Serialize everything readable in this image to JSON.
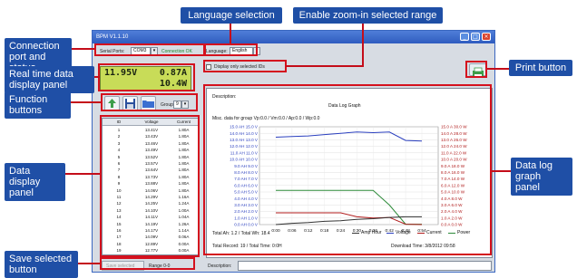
{
  "callouts": {
    "language_selection": "Language selection",
    "enable_zoom": "Enable zoom-in selected range",
    "connection_port": "Connection\nport and status",
    "realtime_display": "Real time data\ndisplay panel",
    "function_buttons": "Function\nbuttons",
    "data_display": "Data display\npanel",
    "save_selected": "Save selected\nbutton",
    "print_button": "Print button",
    "data_log_graph": "Data log\ngraph panel"
  },
  "app": {
    "title": "BPM V1.1.10",
    "serial_label": "Serial Ports:",
    "serial_value": "COM3",
    "connection_status": "Connection OK",
    "language_label": "Language:",
    "language_value": "English",
    "display_only_label": "Display only selected IDs",
    "lcd_voltage": "11.95V",
    "lcd_current": "0.87A",
    "lcd_power": "10.4W",
    "group_label": "Group",
    "group_value": "9",
    "save_selected_label": "Save selected",
    "range_label": "Range 0-0",
    "description_bottom_label": "Description:"
  },
  "table": {
    "headers": [
      "ID",
      "Voltage",
      "Current"
    ],
    "rows": [
      [
        "1",
        "13.41V",
        "1.80A"
      ],
      [
        "2",
        "13.43V",
        "1.80A"
      ],
      [
        "3",
        "13.46V",
        "1.80A"
      ],
      [
        "4",
        "13.49V",
        "1.80A"
      ],
      [
        "5",
        "13.52V",
        "1.80A"
      ],
      [
        "6",
        "13.57V",
        "1.80A"
      ],
      [
        "7",
        "13.64V",
        "1.80A"
      ],
      [
        "8",
        "13.73V",
        "1.80A"
      ],
      [
        "9",
        "13.88V",
        "1.80A"
      ],
      [
        "10",
        "14.06V",
        "1.80A"
      ],
      [
        "11",
        "14.29V",
        "1.16A"
      ],
      [
        "12",
        "14.25V",
        "1.24A"
      ],
      [
        "13",
        "14.10V",
        "1.00A"
      ],
      [
        "14",
        "14.11V",
        "1.04A"
      ],
      [
        "15",
        "14.19V",
        "1.26A"
      ],
      [
        "16",
        "14.17V",
        "1.14A"
      ],
      [
        "17",
        "14.09V",
        "0.06A"
      ],
      [
        "18",
        "12.89V",
        "0.00A"
      ],
      [
        "19",
        "12.77V",
        "0.00A"
      ]
    ]
  },
  "graph": {
    "description_label": "Description:",
    "title": "Data Log Graph",
    "misc": "Misc. data for group Vp:0.0 / Vm:0.0 / Ap:0.0 / Wp:0.0",
    "left_ticks": [
      "15.0 AH  15.0 V",
      "14.0 AH  14.0 V",
      "13.0 AH  13.0 V",
      "12.0 AH  12.0 V",
      "11.0 AH  11.0 V",
      "10.0 AH  10.0 V",
      "9.0 AH  9.0 V",
      "8.0 AH  8.0 V",
      "7.0 AH  7.0 V",
      "6.0 AH  6.0 V",
      "5.0 AH  5.0 V",
      "4.0 AH  4.0 V",
      "3.0 AH  3.0 V",
      "2.0 AH  2.0 V",
      "1.0 AH  1.0 V",
      "0.0 AH  0.0 V"
    ],
    "right_ticks": [
      "15.0 A  30.0 W",
      "14.0 A  28.0 W",
      "13.0 A  26.0 W",
      "12.0 A  24.0 W",
      "11.0 A  22.0 W",
      "10.0 A  20.0 W",
      "9.0 A  18.0 W",
      "8.0 A  16.0 W",
      "7.0 A  14.0 W",
      "6.0 A  12.0 W",
      "5.0 A  10.0 W",
      "4.0 A  8.0 W",
      "3.0 A  6.0 W",
      "2.0 A  4.0 W",
      "1.0 A  2.0 W",
      "0.0 A  0.0 W"
    ],
    "x_ticks": [
      "0:00",
      "0:06",
      "0:12",
      "0:18",
      "0:24",
      "0:30",
      "0:36",
      "0:42",
      "0:48",
      "0:54"
    ],
    "total_ah": "Total Ah: 1.2 / Total Wh: 18.4",
    "total_record": "Total Record: 19 / Total Time: 0:0H",
    "download_time": "Download Time: 3/8/2012 09:58",
    "legend": [
      "Amp Hour",
      "Voltage",
      "Current",
      "Power"
    ],
    "colors": {
      "amp_hour": "#333333",
      "voltage": "#2a3fbf",
      "current": "#b01a1a",
      "power": "#2e8b3a"
    }
  },
  "chart_data": {
    "type": "line",
    "title": "Data Log Graph",
    "x": [
      "0:00",
      "0:06",
      "0:12",
      "0:18",
      "0:24",
      "0:30",
      "0:36",
      "0:42",
      "0:48",
      "0:54"
    ],
    "series": [
      {
        "name": "Voltage",
        "values": [
          13.4,
          13.5,
          13.6,
          13.8,
          14.0,
          14.2,
          14.1,
          14.2,
          12.9,
          12.8
        ]
      },
      {
        "name": "Power",
        "values": [
          10.5,
          10.5,
          10.5,
          10.5,
          10.5,
          10.5,
          10.5,
          6.0,
          0.1,
          0.1
        ]
      },
      {
        "name": "Current",
        "values": [
          1.8,
          1.8,
          1.8,
          1.8,
          1.8,
          1.2,
          1.0,
          1.1,
          0.06,
          0.0
        ]
      },
      {
        "name": "Amp Hour",
        "values": [
          0.0,
          0.2,
          0.3,
          0.5,
          0.6,
          0.8,
          0.9,
          1.1,
          1.2,
          1.2
        ]
      }
    ],
    "ylim": [
      0,
      15
    ],
    "grid": true,
    "legend": "bottom-right"
  }
}
